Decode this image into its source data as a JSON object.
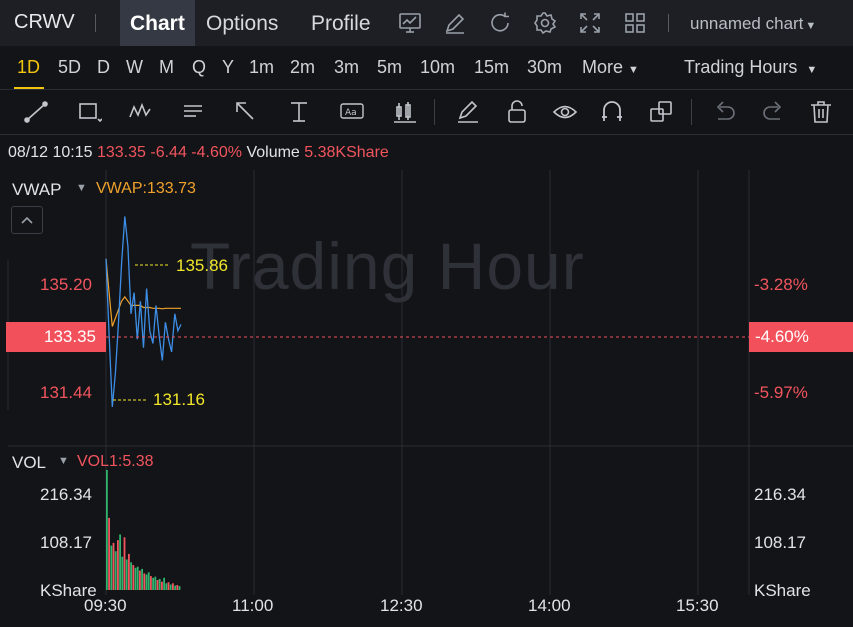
{
  "header": {
    "symbol": "CRWV",
    "tabs": [
      {
        "label": "Chart",
        "active": true
      },
      {
        "label": "Options",
        "active": false
      },
      {
        "label": "Profile",
        "active": false
      }
    ],
    "icons": [
      "chart-monitor-icon",
      "pencil-edit-icon",
      "refresh-icon",
      "gear-icon",
      "fullscreen-icon",
      "grid-layout-icon"
    ],
    "chart_name": "unnamed chart"
  },
  "intervals": {
    "items": [
      "1D",
      "5D",
      "D",
      "W",
      "M",
      "Q",
      "Y",
      "1m",
      "2m",
      "3m",
      "5m",
      "10m",
      "15m",
      "30m"
    ],
    "active": "1D",
    "more_label": "More",
    "session_label": "Trading Hours"
  },
  "drawing_tools": [
    "trend-line-icon",
    "rectangle-icon",
    "pattern-icon",
    "text-note-icon",
    "arrow-icon",
    "price-range-icon",
    "text-label-icon",
    "candle-icon",
    "brush-icon",
    "unlock-icon",
    "eye-icon",
    "magnet-icon",
    "copy-layers-icon",
    "undo-icon",
    "redo-icon",
    "trash-icon"
  ],
  "info_bar": {
    "datetime": "08/12 10:15",
    "price": "133.35",
    "change": "-6.44",
    "change_pct": "-4.60%",
    "volume_label": "Volume",
    "volume_value": "5.38KShare"
  },
  "price_pane": {
    "indicator": "VWAP",
    "indicator_value": "VWAP:133.73",
    "watermark": "Trading Hour",
    "left_axis": [
      "135.20",
      "131.44"
    ],
    "right_axis": [
      "-3.28%",
      "-5.97%"
    ],
    "current_price": "133.35",
    "current_pct": "-4.60%",
    "high_label": "135.86",
    "low_label": "131.16"
  },
  "volume_pane": {
    "indicator": "VOL",
    "indicator_value": "VOL1:5.38",
    "axis": [
      "216.34",
      "108.17",
      "KShare"
    ]
  },
  "time_axis": [
    "09:30",
    "11:00",
    "12:30",
    "14:00",
    "15:30"
  ],
  "colors": {
    "up": "#2fb36e",
    "down": "#f0555e",
    "line": "#3d8ee6",
    "vwap": "#f0a12b",
    "accent": "#f1c40f"
  },
  "chart_data": {
    "type": "line",
    "x_range": [
      "09:30",
      "16:00"
    ],
    "price_line": [
      134.9,
      133.1,
      131.4,
      132.2,
      133.4,
      134.8,
      135.9,
      135.2,
      133.6,
      134.1,
      133.0,
      133.9,
      132.8,
      134.2,
      133.2,
      132.9,
      133.8,
      133.1,
      132.5,
      133.4,
      133.0,
      132.7,
      133.6,
      133.2,
      133.35
    ],
    "vwap_line": [
      134.9,
      134.1,
      133.3,
      133.5,
      133.7,
      133.9,
      134.0,
      133.9,
      133.8,
      133.8,
      133.8,
      133.8,
      133.75,
      133.75,
      133.75,
      133.73,
      133.73,
      133.73,
      133.72,
      133.73,
      133.73,
      133.73,
      133.73,
      133.73,
      133.73
    ],
    "volume": [
      216.3,
      130.0,
      80.0,
      85.0,
      70.0,
      90.0,
      100.0,
      60.0,
      95.0,
      55.0,
      65.0,
      50.0,
      45.0,
      40.0,
      42.0,
      35.0,
      38.0,
      30.0,
      28.0,
      32.0,
      25.0,
      22.0,
      24.0,
      18.0,
      20.0,
      15.0,
      22.0,
      12.0,
      14.0,
      10.0,
      12.0,
      8.0,
      9.0,
      7.0
    ],
    "volume_up": [
      true,
      false,
      true,
      false,
      true,
      false,
      true,
      true,
      false,
      true,
      false,
      true,
      false,
      true,
      true,
      false,
      true,
      false,
      true,
      true,
      false,
      true,
      true,
      false,
      true,
      false,
      true,
      true,
      false,
      true,
      false,
      true,
      false,
      true
    ],
    "ylim_price": [
      130.5,
      137.0
    ],
    "ylim_volume": [
      0,
      216.34
    ],
    "grid": true
  }
}
